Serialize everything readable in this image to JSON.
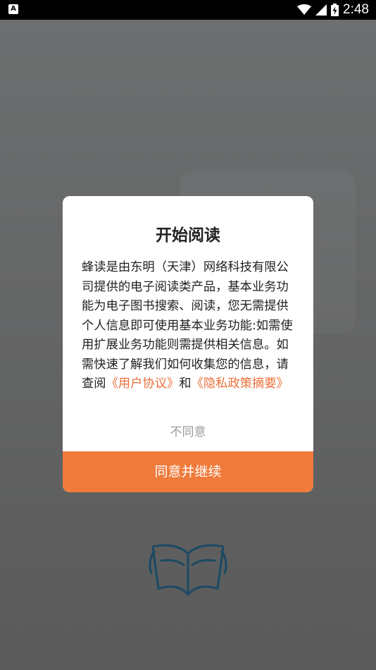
{
  "status_bar": {
    "notification_icon": "A",
    "time": "2:48",
    "icons": [
      "wifi-icon",
      "signal-icon",
      "battery-charging-icon"
    ]
  },
  "dialog": {
    "title": "开始阅读",
    "body_part1": "蜂读是由东明（天津）网络科技有限公司提供的电子阅读类产品，基本业务功能为电子图书搜索、阅读，您无需提供个人信息即可使用基本业务功能:如需使用扩展业务功能则需提供相关信息。如需快速了解我们如何收集您的信息，请查阅",
    "user_agreement_link": "《用户协议》",
    "and_text": "和",
    "privacy_link": "《隐私政策摘要》",
    "disagree_label": "不同意",
    "agree_label": "同意并继续"
  },
  "colors": {
    "accent": "#f07a3a",
    "link": "#ec6f3a",
    "logo": "#1c4a63"
  }
}
